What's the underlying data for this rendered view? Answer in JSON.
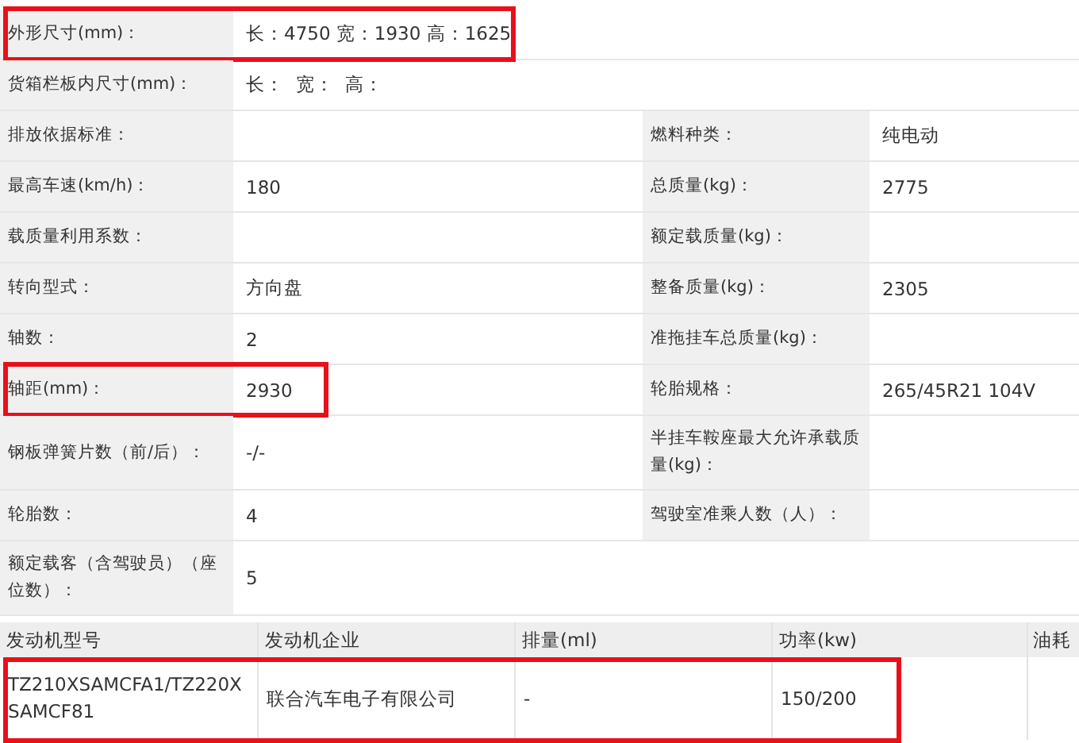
{
  "spec_rows": [
    {
      "label": "外形尺寸(mm)：",
      "value": "长：4750 宽：1930 高：1625",
      "highlighted": true
    },
    {
      "label": "货箱栏板内尺寸(mm)：",
      "value": "长：  宽：  高：",
      "highlighted": false
    },
    {
      "label": "排放依据标准：",
      "label_2": "燃料种类：",
      "value_2": "纯电动",
      "highlighted": false
    },
    {
      "label": "最高车速(km/h)：",
      "value": "180",
      "label_2": "总质量(kg)：",
      "value_2": "2775",
      "highlighted": false
    },
    {
      "label": "载质量利用系数：",
      "label_2": "额定载质量(kg)：",
      "highlighted": false
    },
    {
      "label": "转向型式：",
      "value": "方向盘",
      "label_2": "整备质量(kg)：",
      "value_2": "2305",
      "highlighted": false
    },
    {
      "label": "轴数：",
      "value": "2",
      "label_2": "准拖挂车总质量(kg)：",
      "highlighted": false
    },
    {
      "label": "轴距(mm)：",
      "value": "2930",
      "label_2": "轮胎规格：",
      "value_2": "265/45R21 104V",
      "highlighted": true
    },
    {
      "label": "钢板弹簧片数（前/后）：",
      "value": "-/-",
      "label_2": "半挂车鞍座最大允许承载质量(kg)：",
      "highlighted": false
    },
    {
      "label": "轮胎数：",
      "value": "4",
      "label_2": "驾驶室准乘人数（人）：",
      "highlighted": false
    },
    {
      "label": "额定载客（含驾驶员）（座位数）：",
      "value": "5",
      "highlighted": false
    }
  ],
  "engine_table": {
    "columns": [
      "发动机型号",
      "发动机企业",
      "排量(ml)",
      "功率(kw)",
      "油耗"
    ],
    "rows": [
      {
        "cells": [
          "TZ210XSAMCFA1/TZ220XSAMCF81",
          "联合汽车电子有限公司",
          "-",
          "150/200",
          ""
        ],
        "highlighted": true
      }
    ]
  }
}
